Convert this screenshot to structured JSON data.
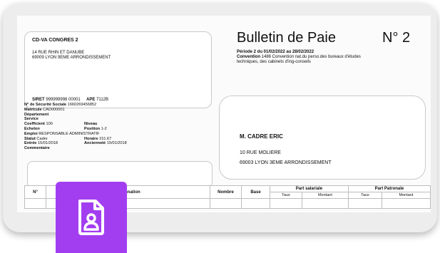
{
  "employer": {
    "name": "CD-VA CONGRES 2",
    "address1": "14 RUE RHIN ET DANUBE",
    "address2": "69009 LYON 9EME ARRONDISSEMENT",
    "siret_label": "SIRET",
    "siret": "999999998 00001",
    "ape_label": "APE",
    "ape": "7112B"
  },
  "document": {
    "title": "Bulletin de Paie",
    "number": "N° 2",
    "period_label": "Période 2 du 01/02/2022 au 28/02/2022",
    "convention_label": "Convention",
    "convention_text": "1486 Convention nat.du perso.des bureaux d'études",
    "convention_text2": "techniques, des cabinets d'ing-conseils"
  },
  "employee_info": {
    "secu_label": "N° de Sécurité Sociale",
    "secu": "1660269456852",
    "matricule_label": "Matricule",
    "matricule": "CAD000001",
    "departement_label": "Département",
    "service_label": "Service",
    "coefficient_label": "Coefficient",
    "coefficient": "100",
    "niveau_label": "Niveau",
    "echelon_label": "Echelon",
    "position_label": "Position",
    "position": "1-2",
    "emploi_label": "Emploi",
    "emploi": "RESPONSABLE ADMINISTRATIF",
    "statut_label": "Statut",
    "statut": "Cadre",
    "horaire_label": "Horaire",
    "horaire": "151.67",
    "entree_label": "Entrée",
    "entree": "15/01/2018",
    "anciennete_label": "Ancienneté",
    "anciennete": "15/01/2018",
    "commentaire_label": "Commentaire"
  },
  "employee": {
    "name": "M. CADRE ERIC",
    "address1": "10 RUE MOLIERE",
    "address2": "69003 LYON 3EME ARRONDISSEMENT"
  },
  "table": {
    "col_n": "N°",
    "col_designation": "Désignation",
    "col_nombre": "Nombre",
    "col_base": "Base",
    "group_salariale": "Part salariale",
    "group_patronale": "Part Patronale",
    "taux": "Taux",
    "montant": "Montant"
  },
  "badge": {
    "icon": "document-person-icon",
    "color": "#a23ef0"
  }
}
